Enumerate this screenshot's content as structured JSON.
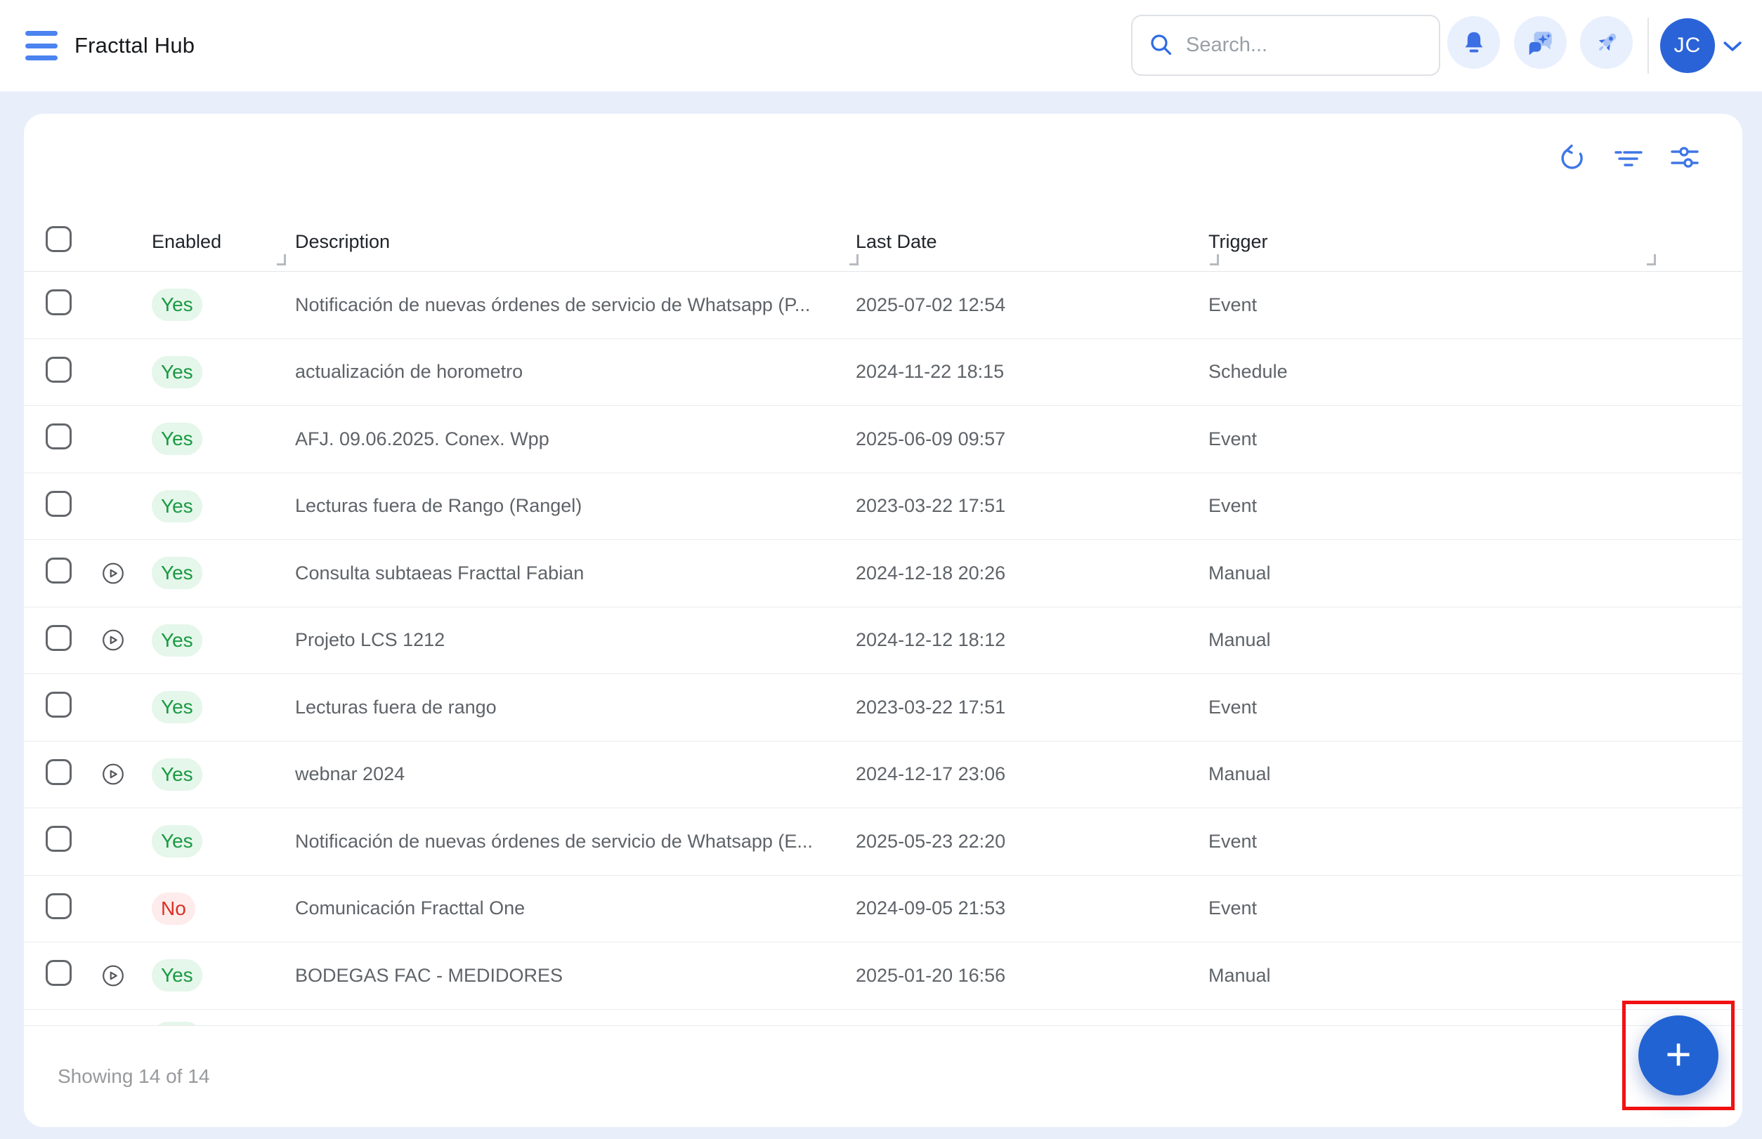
{
  "app": {
    "title": "Fracttal Hub"
  },
  "topbar": {
    "search": {
      "placeholder": "Search..."
    },
    "avatar": {
      "initials": "JC"
    },
    "icons": [
      "menu-icon",
      "search-icon",
      "bell-icon",
      "chat-sparkles-icon",
      "rocket-icon",
      "chevron-down-icon"
    ]
  },
  "card_toolbar": {
    "icons": [
      "refresh-icon",
      "filter-icon",
      "sliders-icon"
    ]
  },
  "table": {
    "columns": [
      {
        "label": "Enabled"
      },
      {
        "label": "Description"
      },
      {
        "label": "Last Date"
      },
      {
        "label": "Trigger"
      }
    ],
    "rows": [
      {
        "enabled": "Yes",
        "has_play": false,
        "description": "Notificación de nuevas órdenes de servicio de Whatsapp (P...",
        "last_date": "2025-07-02 12:54",
        "trigger": "Event"
      },
      {
        "enabled": "Yes",
        "has_play": false,
        "description": "actualización de horometro",
        "last_date": "2024-11-22 18:15",
        "trigger": "Schedule"
      },
      {
        "enabled": "Yes",
        "has_play": false,
        "description": "AFJ. 09.06.2025. Conex. Wpp",
        "last_date": "2025-06-09 09:57",
        "trigger": "Event"
      },
      {
        "enabled": "Yes",
        "has_play": false,
        "description": "Lecturas fuera de Rango (Rangel)",
        "last_date": "2023-03-22 17:51",
        "trigger": "Event"
      },
      {
        "enabled": "Yes",
        "has_play": true,
        "description": "Consulta subtaeas Fracttal Fabian",
        "last_date": "2024-12-18 20:26",
        "trigger": "Manual"
      },
      {
        "enabled": "Yes",
        "has_play": true,
        "description": "Projeto LCS 1212",
        "last_date": "2024-12-12 18:12",
        "trigger": "Manual"
      },
      {
        "enabled": "Yes",
        "has_play": false,
        "description": "Lecturas fuera de rango",
        "last_date": "2023-03-22 17:51",
        "trigger": "Event"
      },
      {
        "enabled": "Yes",
        "has_play": true,
        "description": "webnar 2024",
        "last_date": "2024-12-17 23:06",
        "trigger": "Manual"
      },
      {
        "enabled": "Yes",
        "has_play": false,
        "description": "Notificación de nuevas órdenes de servicio de Whatsapp (E...",
        "last_date": "2025-05-23 22:20",
        "trigger": "Event"
      },
      {
        "enabled": "No",
        "has_play": false,
        "description": "Comunicación Fracttal One",
        "last_date": "2024-09-05 21:53",
        "trigger": "Event"
      },
      {
        "enabled": "Yes",
        "has_play": true,
        "description": "BODEGAS FAC - MEDIDORES",
        "last_date": "2025-01-20 16:56",
        "trigger": "Manual"
      }
    ],
    "partial_row": {
      "enabled": "Yes",
      "has_play": true,
      "description": "",
      "last_date": "",
      "trigger": ""
    }
  },
  "footer": {
    "showing": "Showing 14 of 14"
  },
  "fab": {
    "label": "+"
  },
  "colors": {
    "accent": "#3f76e6",
    "fab": "#2263d3",
    "yes_text": "#1a9a43",
    "yes_bg": "#e5f6ea",
    "no_text": "#d93025",
    "no_bg": "#fdeceb",
    "annotation": "#f01212",
    "page_bg": "#e9eefb"
  }
}
